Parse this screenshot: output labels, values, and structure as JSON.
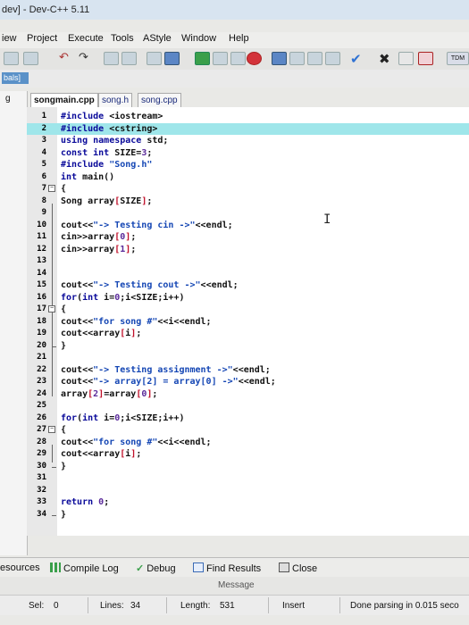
{
  "window": {
    "title": "dev] - Dev-C++ 5.11"
  },
  "menu": [
    "iew",
    "Project",
    "Execute",
    "Tools",
    "AStyle",
    "Window",
    "Help"
  ],
  "toolbar_right_label": "TDM",
  "combo_text": "bals]",
  "left_panel_label": "g",
  "tabs": [
    {
      "label": "songmain.cpp",
      "active": true
    },
    {
      "label": "song.h",
      "active": false
    },
    {
      "label": "song.cpp",
      "active": false
    }
  ],
  "code_lines": [
    {
      "n": "1",
      "t": "#include <iostream>"
    },
    {
      "n": "2",
      "t": "#include <cstring>"
    },
    {
      "n": "3",
      "t": "using namespace std;"
    },
    {
      "n": "4",
      "t": "const int SIZE=3;"
    },
    {
      "n": "5",
      "t": "#include \"Song.h\""
    },
    {
      "n": "6",
      "t": "int main()"
    },
    {
      "n": "7",
      "t": "{"
    },
    {
      "n": "8",
      "t": "Song array[SIZE];"
    },
    {
      "n": "9",
      "t": ""
    },
    {
      "n": "10",
      "t": "cout<<\"-> Testing cin ->\"<<endl;"
    },
    {
      "n": "11",
      "t": "cin>>array[0];"
    },
    {
      "n": "12",
      "t": "cin>>array[1];"
    },
    {
      "n": "13",
      "t": ""
    },
    {
      "n": "14",
      "t": ""
    },
    {
      "n": "15",
      "t": "cout<<\"-> Testing cout ->\"<<endl;"
    },
    {
      "n": "16",
      "t": "for(int i=0;i<SIZE;i++)"
    },
    {
      "n": "17",
      "t": "{"
    },
    {
      "n": "18",
      "t": "cout<<\"for song #\"<<i<<endl;"
    },
    {
      "n": "19",
      "t": "cout<<array[i];"
    },
    {
      "n": "20",
      "t": "}"
    },
    {
      "n": "21",
      "t": ""
    },
    {
      "n": "22",
      "t": "cout<<\"-> Testing assignment ->\"<<endl;"
    },
    {
      "n": "23",
      "t": "cout<<\"-> array[2] = array[0] ->\"<<endl;"
    },
    {
      "n": "24",
      "t": "array[2]=array[0];"
    },
    {
      "n": "25",
      "t": ""
    },
    {
      "n": "26",
      "t": "for(int i=0;i<SIZE;i++)"
    },
    {
      "n": "27",
      "t": "{"
    },
    {
      "n": "28",
      "t": "cout<<\"for song #\"<<i<<endl;"
    },
    {
      "n": "29",
      "t": "cout<<array[i];"
    },
    {
      "n": "30",
      "t": "}"
    },
    {
      "n": "31",
      "t": ""
    },
    {
      "n": "32",
      "t": ""
    },
    {
      "n": "33",
      "t": "return 0;"
    },
    {
      "n": "34",
      "t": "}"
    }
  ],
  "bottom_tabs": {
    "resources": "esources",
    "compile_log": "Compile Log",
    "debug": "Debug",
    "find_results": "Find Results",
    "close": "Close"
  },
  "message_label": "Message",
  "status": {
    "sel_label": "Sel:",
    "sel_value": "0",
    "lines_label": "Lines:",
    "lines_value": "34",
    "length_label": "Length:",
    "length_value": "531",
    "mode": "Insert",
    "parse": "Done parsing in 0.015 seco"
  },
  "colors": {
    "highlight": "#9fe6ea",
    "keyword": "#0a0a9a",
    "string": "#1446b4",
    "number": "#5a2a9a",
    "bracket": "#c0102a"
  }
}
